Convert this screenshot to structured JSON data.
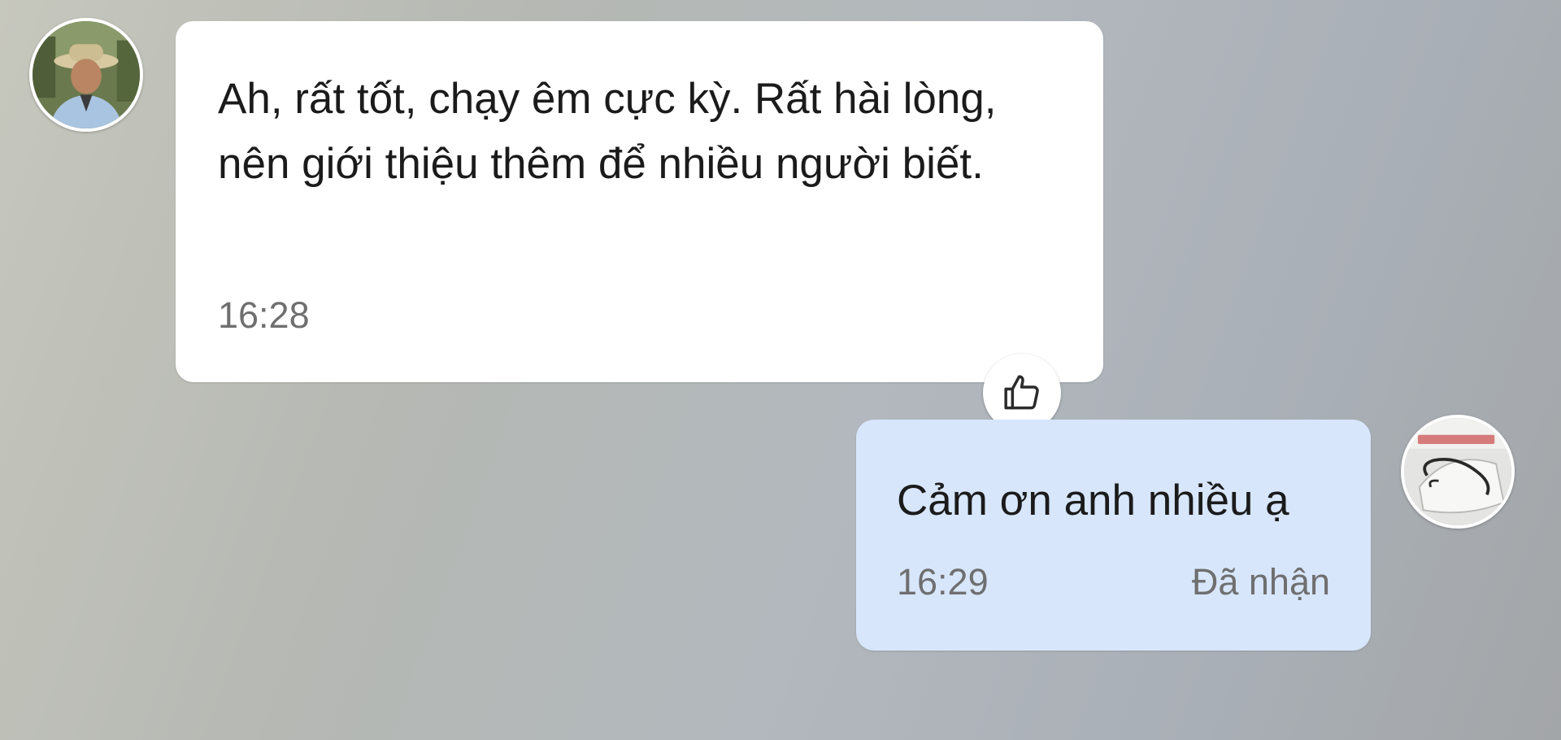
{
  "conversation": {
    "incoming": {
      "text": "Ah, rất tốt, chạy êm cực kỳ. Rất hài lòng, nên giới thiệu thêm để nhiều người biết.",
      "time": "16:28",
      "reaction_icon": "thumbs-up-icon"
    },
    "outgoing": {
      "text": "Cảm ơn anh nhiều ạ",
      "time": "16:29",
      "status": "Đã nhận"
    }
  },
  "colors": {
    "incoming_bubble": "#ffffff",
    "outgoing_bubble": "#d7e6fb",
    "timestamp": "#6f6f6f"
  }
}
